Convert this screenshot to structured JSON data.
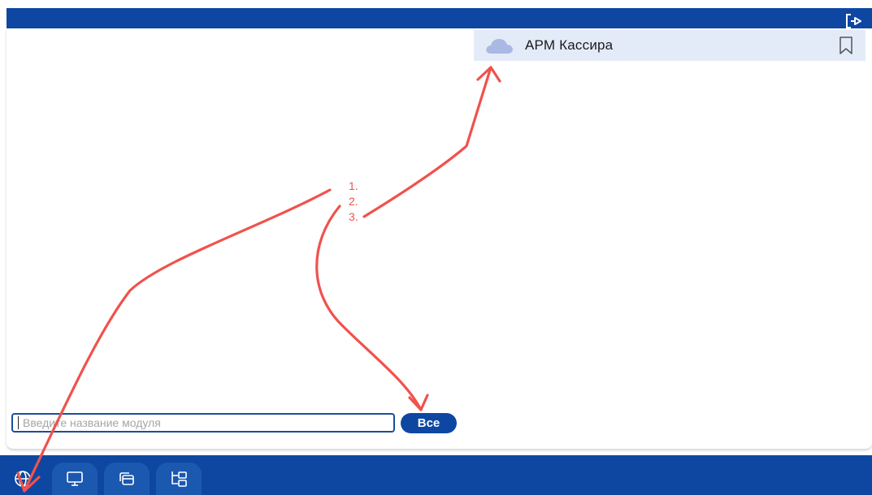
{
  "module_list": {
    "items": [
      {
        "label": "АРМ Кассира",
        "icon": "cloud-icon",
        "bookmark_icon": "bookmark-icon"
      }
    ],
    "highlight_color": "#e4ebf8"
  },
  "search": {
    "placeholder": "Введите название модуля",
    "value": ""
  },
  "filter": {
    "all_label": "Все"
  },
  "header": {
    "logout_icon": "logout-icon",
    "color": "#0e47a1"
  },
  "bottom_nav": {
    "tabs": [
      {
        "icon": "globe-icon",
        "active": true
      },
      {
        "icon": "monitor-icon",
        "active": false
      },
      {
        "icon": "windows-icon",
        "active": false
      },
      {
        "icon": "tree-icon",
        "active": false
      }
    ],
    "color": "#0e47a1"
  },
  "annotations": {
    "steps": [
      "1.",
      "2.",
      "3."
    ],
    "color": "#f0524d"
  }
}
